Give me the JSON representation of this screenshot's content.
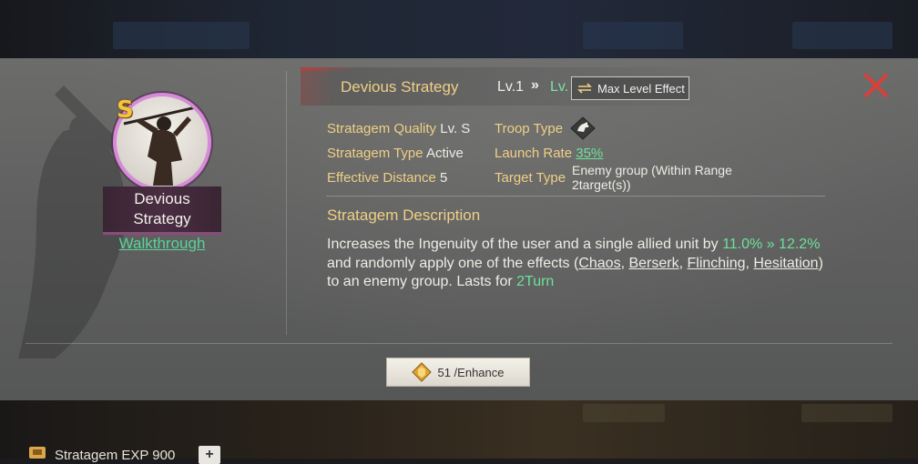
{
  "stratagem": {
    "grade": "S",
    "name": "Devious Strategy",
    "walkthrough": "Walkthrough",
    "level_current": "Lv.1",
    "level_arrow": "»",
    "level_next": "Lv.",
    "max_level_button": "Max Level Effect"
  },
  "attributes": {
    "quality_key": "Stratagem Quality",
    "quality_val": "Lv. S",
    "type_key": "Stratagem Type",
    "type_val": "Active",
    "distance_key": "Effective Distance",
    "distance_val": "5",
    "troop_key": "Troop Type",
    "troop_icon": "cavalry-horse-icon",
    "launch_key": "Launch Rate",
    "launch_val": "35%",
    "target_key": "Target Type",
    "target_val_line1": "Enemy group (Within Range",
    "target_val_line2": "2target(s))"
  },
  "description": {
    "title": "Stratagem Description",
    "p1": "Increases the Ingenuity of the user and a single allied unit by ",
    "val1": "11.0%",
    "arrow": " » ",
    "val2": "12.2%",
    "p2": " and randomly apply one of the effects (",
    "e1": "Chaos",
    "sep1": ", ",
    "e2": "Berserk",
    "sep2": ", ",
    "e3": "Flinching",
    "sep3": ", ",
    "e4": "Hesitation",
    "p3": ") to an enemy group. Lasts for ",
    "val3": "2Turn"
  },
  "enhance": {
    "label": "51 /Enhance"
  },
  "footer": {
    "label": "Stratagem EXP 900",
    "plus": "+"
  },
  "colors": {
    "gold_text": "#f0cf85",
    "green_text": "#6fe09a",
    "close_red": "#d8403a",
    "grade_gold": "#f5c33b",
    "ring_purple": "#d68bd8"
  }
}
